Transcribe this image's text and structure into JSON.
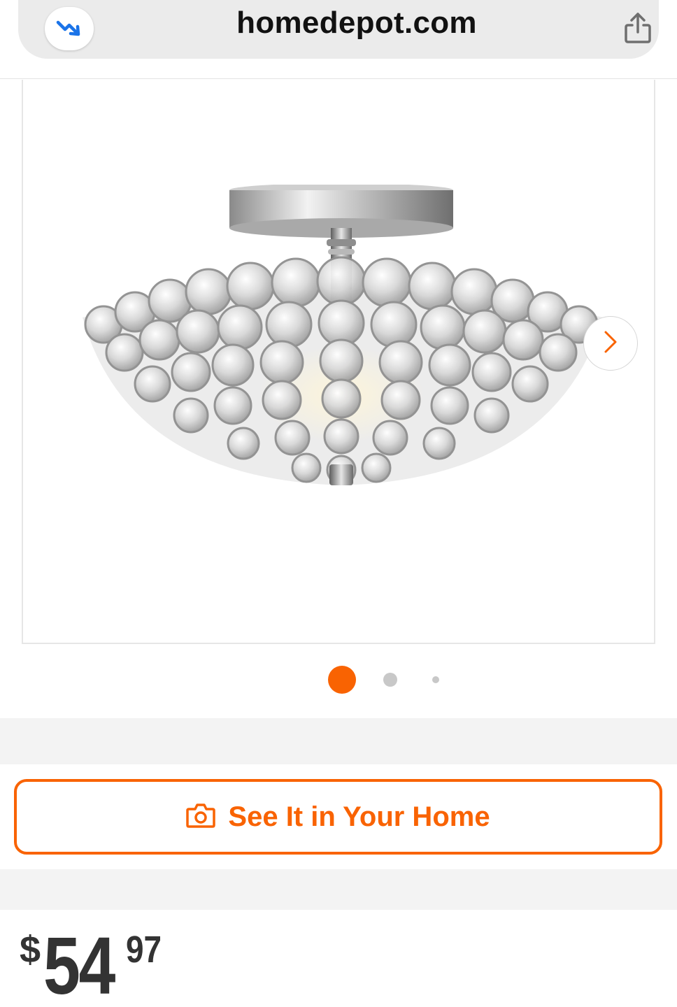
{
  "browser": {
    "url": "homedepot.com",
    "reader_icon": "trend-down-arrow-icon",
    "share_icon": "share-icon"
  },
  "gallery": {
    "image_alt": "Crystal bowl semi-flush mount ceiling light with chrome canopy",
    "next_icon": "chevron-right-icon",
    "dots": [
      {
        "state": "active"
      },
      {
        "state": "inactive"
      },
      {
        "state": "inactive"
      }
    ]
  },
  "ar": {
    "label": "See It in Your Home",
    "icon": "camera-icon"
  },
  "price": {
    "currency": "$",
    "dollars": "54",
    "cents": "97"
  },
  "colors": {
    "brand_orange": "#f96302",
    "price_text": "#333333",
    "inactive_dot": "#c8c8c8"
  }
}
